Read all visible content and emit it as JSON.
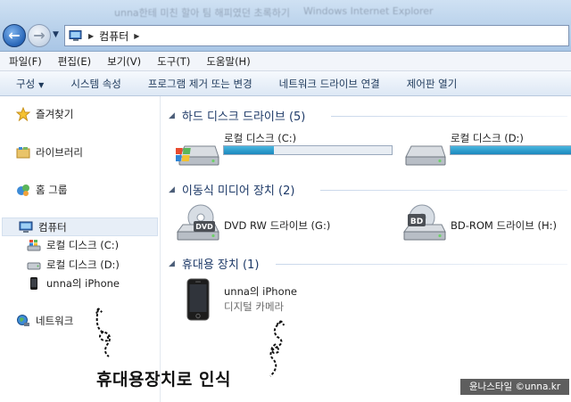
{
  "window": {
    "title_left": "unna한테 미친 할아 팀 해피였던 초록하기",
    "title": "Windows Internet Explorer"
  },
  "address": {
    "path": "컴퓨터"
  },
  "menu": [
    "파일(F)",
    "편집(E)",
    "보기(V)",
    "도구(T)",
    "도움말(H)"
  ],
  "commands": {
    "organize": "구성",
    "items": [
      "시스템 속성",
      "프로그램 제거 또는 변경",
      "네트워크 드라이브 연결",
      "제어판 열기"
    ]
  },
  "sidebar": {
    "favorites": "즐겨찾기",
    "libraries": "라이브러리",
    "homegroup": "홈 그룹",
    "computer": "컴퓨터",
    "local_c": "로컬 디스크 (C:)",
    "local_d": "로컬 디스크 (D:)",
    "iphone": "unna의 iPhone",
    "network": "네트워크"
  },
  "groups": {
    "hdd": "하드 디스크 드라이브 (5)",
    "removable": "이동식 미디어 장치 (2)",
    "portable": "휴대용 장치 (1)"
  },
  "drives": {
    "c": {
      "name": "로컬 디스크 (C:)",
      "used_fraction": 0.3
    },
    "d": {
      "name": "로컬 디스크 (D:)",
      "used_fraction": 1.0
    },
    "dvd": {
      "name": "DVD RW 드라이브 (G:)",
      "badge": "DVD"
    },
    "bd": {
      "name": "BD-ROM 드라이브 (H:)",
      "badge": "BD"
    }
  },
  "device": {
    "name": "unna의 iPhone",
    "type": "디지털 카메라"
  },
  "annotation": "휴대용장치로 인식",
  "watermark": "윤나스타일 ©unna.kr"
}
